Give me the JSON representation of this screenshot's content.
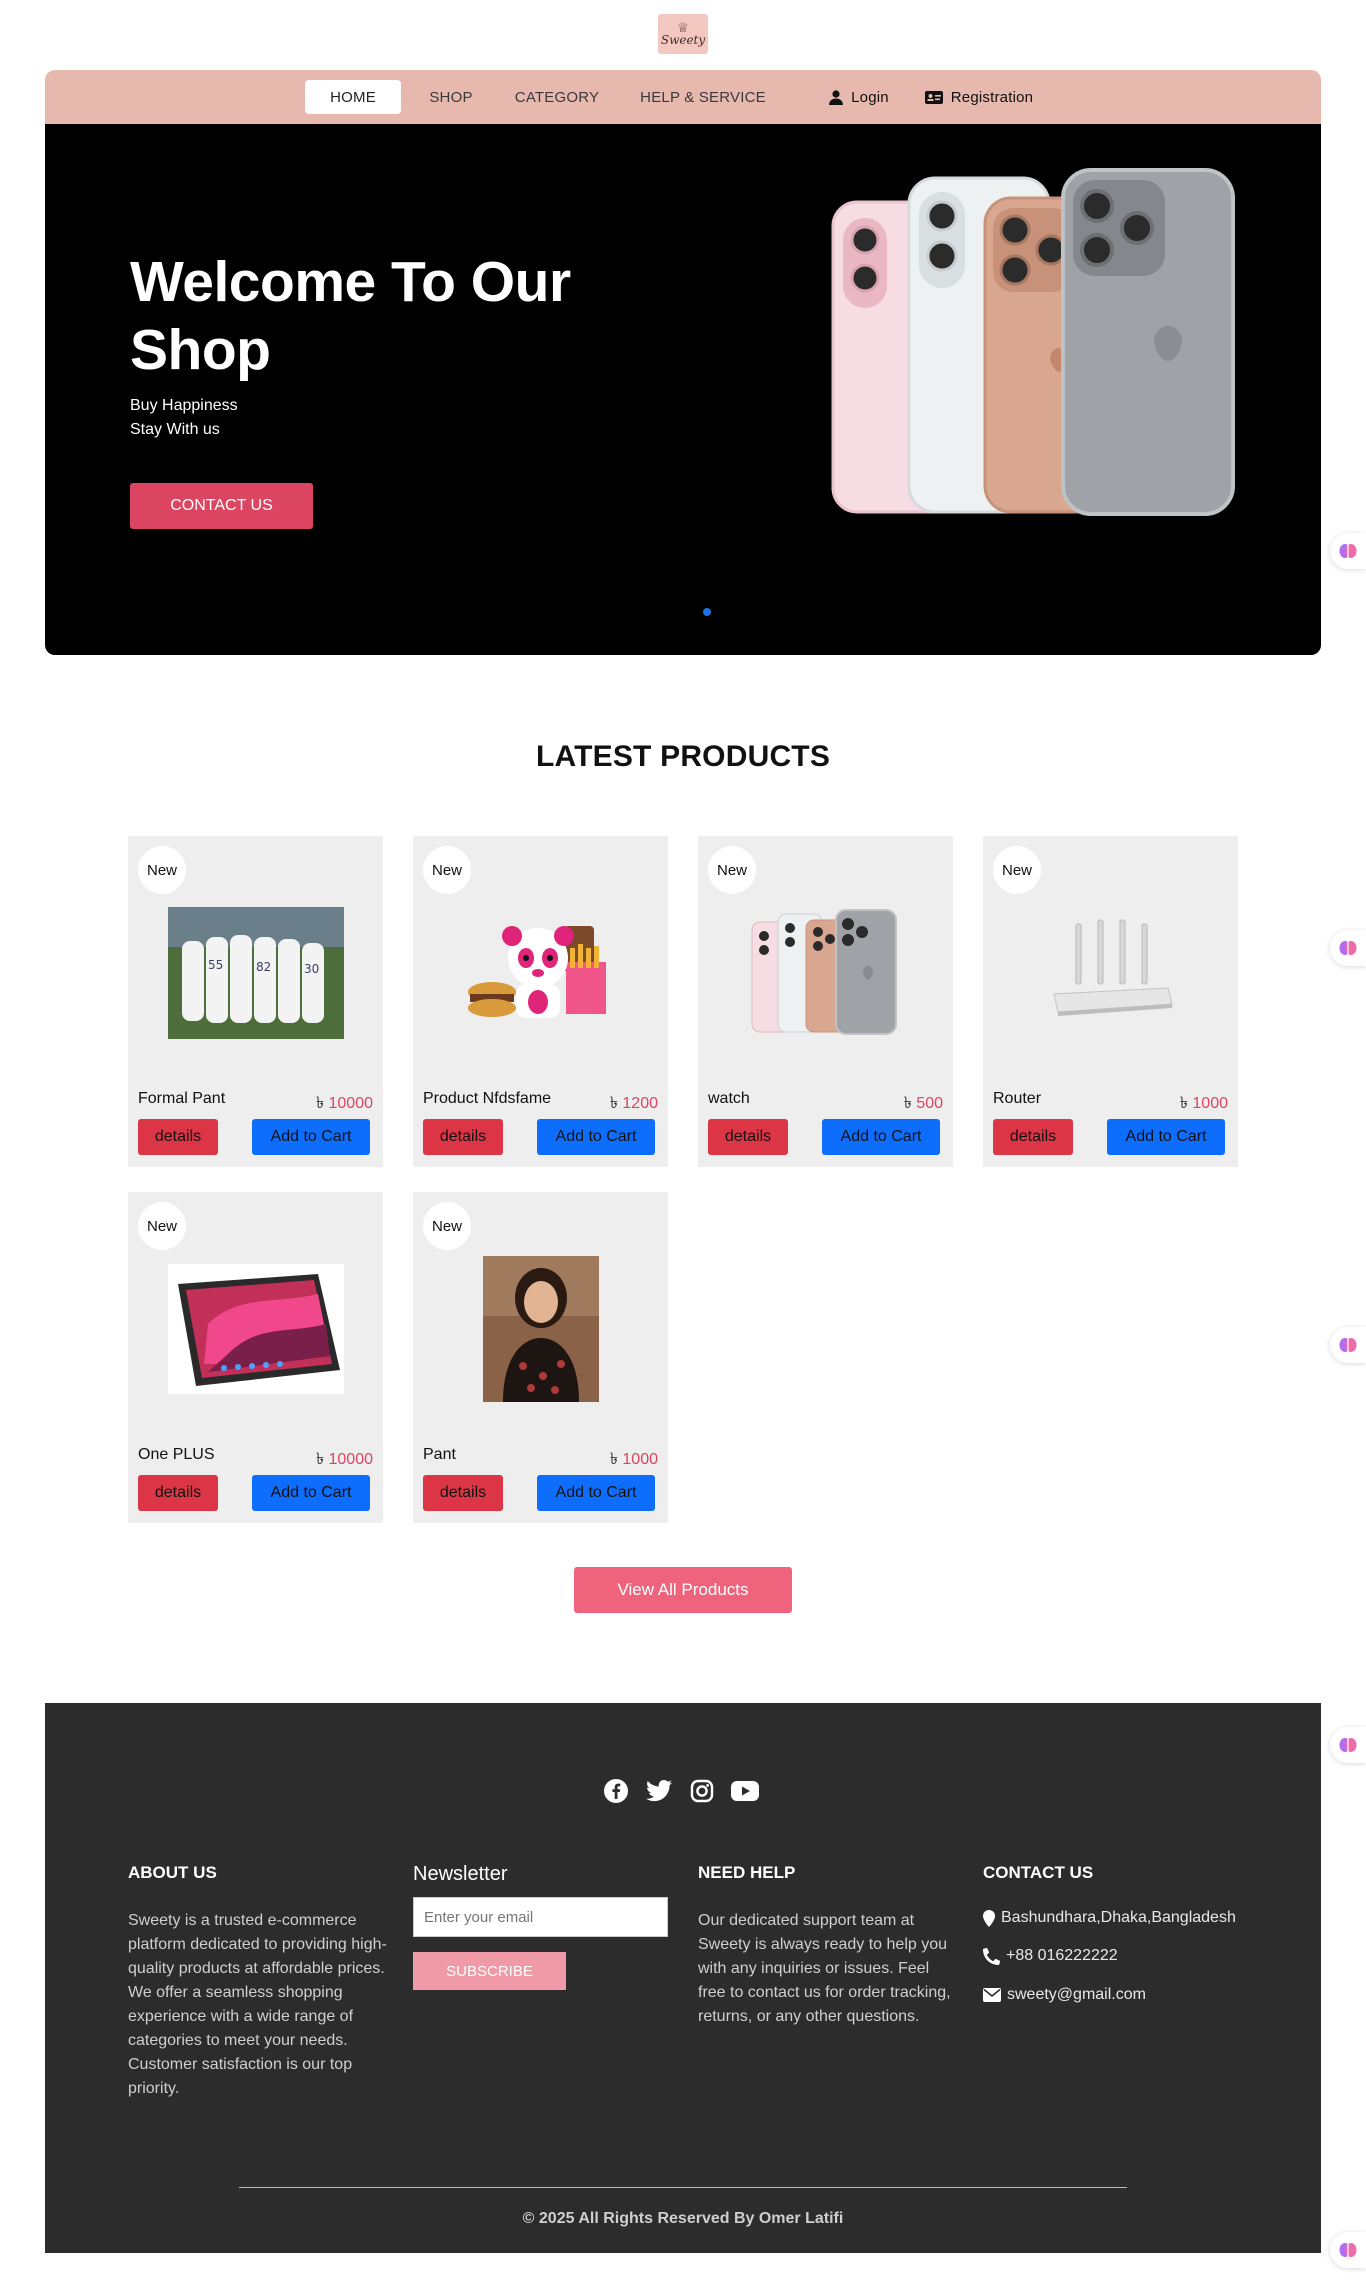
{
  "brand": {
    "logo_text": "Sweety"
  },
  "nav": {
    "home": "HOME",
    "shop": "SHOP",
    "category": "CATEGORY",
    "help": "HELP & SERVICE",
    "login": "Login",
    "registration": "Registration"
  },
  "hero": {
    "title": "Welcome To Our Shop",
    "line1": "Buy Happiness",
    "line2": "Stay With us",
    "cta": "CONTACT US"
  },
  "products_section": {
    "title": "LATEST PRODUCTS",
    "badge": "New",
    "details_label": "details",
    "cart_label": "Add to Cart",
    "currency": "৳",
    "items": [
      {
        "name": "Formal Pant",
        "price": "10000",
        "image": "cricket-team-photo"
      },
      {
        "name": "Product Nfdsfame",
        "price": "1200",
        "image": "panda-food-photo"
      },
      {
        "name": "watch",
        "price": "500",
        "image": "phones-photo"
      },
      {
        "name": "Router",
        "price": "1000",
        "image": "router-photo"
      },
      {
        "name": "One PLUS",
        "price": "10000",
        "image": "tablet-photo"
      },
      {
        "name": "Pant",
        "price": "1000",
        "image": "woman-portrait-photo"
      }
    ],
    "view_all": "View All Products"
  },
  "footer": {
    "social_icons": [
      "facebook-icon",
      "twitter-icon",
      "instagram-icon",
      "youtube-icon"
    ],
    "about": {
      "title": "ABOUT US",
      "text": "Sweety is a trusted e-commerce platform dedicated to providing high-quality products at affordable prices. We offer a seamless shopping experience with a wide range of categories to meet your needs. Customer satisfaction is our top priority."
    },
    "newsletter": {
      "title": "Newsletter",
      "placeholder": "Enter your email",
      "button": "SUBSCRIBE"
    },
    "help": {
      "title": "NEED HELP",
      "text": "Our dedicated support team at Sweety is always ready to help you with any inquiries or issues. Feel free to contact us for order tracking, returns, or any other questions."
    },
    "contact": {
      "title": "CONTACT US",
      "address": "Bashundhara,Dhaka,Bangladesh",
      "phone": "+88 016222222",
      "email": "sweety@gmail.com"
    },
    "copyright": "© 2025 All Rights Reserved By Omer Latifi"
  },
  "colors": {
    "nav_bg": "#e6b8ae",
    "accent_pink": "#dc4561",
    "cart_blue": "#0d6efd",
    "details_red": "#dc3545",
    "footer_bg": "#2c2c2c"
  }
}
